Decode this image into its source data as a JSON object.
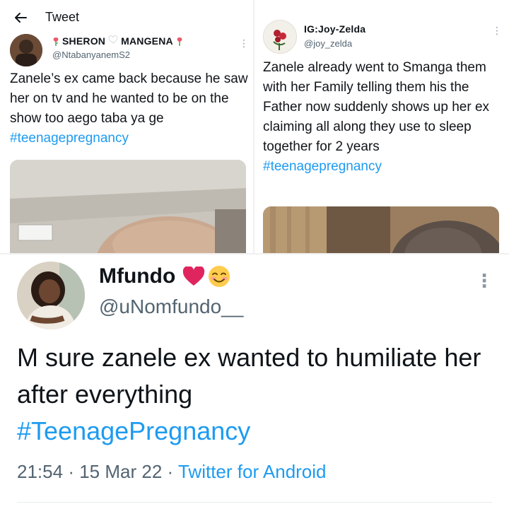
{
  "header": {
    "title": "Tweet"
  },
  "tweet_left": {
    "name_part1": "SHERON",
    "name_part2": "MANGENA",
    "handle": "@NtabanyanemS2",
    "text": "Zanele’s ex came back because he saw her on tv and he wanted to be on the show too aego taba ya ge",
    "hashtag": "#teenagepregnancy",
    "avatar_icon": "profile-photo",
    "media_icon": "photo-ceiling-head"
  },
  "tweet_right": {
    "name": "IG:Joy-Zelda",
    "handle": "@joy_zelda",
    "text": "Zanele already went to Smanga them with her Family telling them his the Father now suddenly shows up her ex claiming all along they use to sleep together for 2 years",
    "hashtag": "#teenagepregnancy",
    "avatar_icon": "roses-photo",
    "media_icon": "photo-head"
  },
  "tweet_bottom": {
    "name": "Mfundo",
    "handle": "@uNomfundo__",
    "text": "M sure zanele ex wanted to humiliate her after everything",
    "hashtag": "#TeenagePregnancy",
    "time": "21:54",
    "sep1": "·",
    "date": "15 Mar 22",
    "sep2": "·",
    "source": "Twitter for Android",
    "avatar_icon": "profile-photo-woman"
  },
  "colors": {
    "accent": "#1d9bf0",
    "text": "#0f1419",
    "muted": "#536471",
    "heart": "#e0245e"
  }
}
